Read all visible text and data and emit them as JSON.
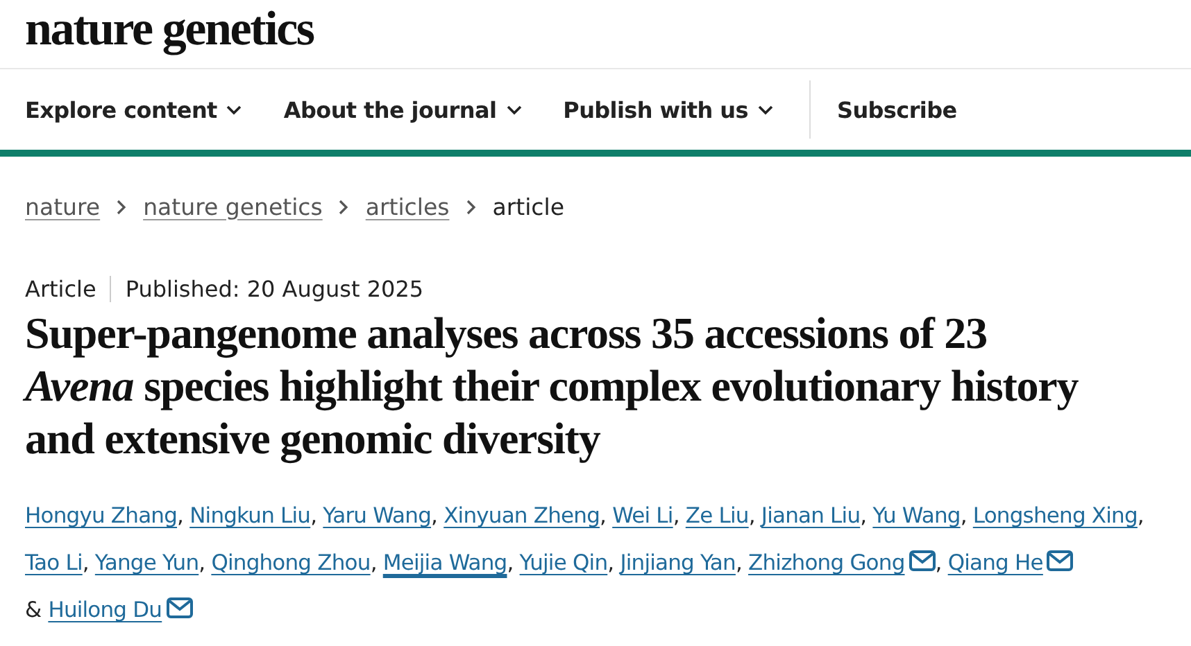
{
  "logo": "nature genetics",
  "nav": [
    {
      "label": "Explore content",
      "dropdown": true
    },
    {
      "label": "About the journal",
      "dropdown": true
    },
    {
      "label": "Publish with us",
      "dropdown": true
    },
    {
      "label": "Subscribe",
      "dropdown": false
    }
  ],
  "breadcrumbs": [
    {
      "label": "nature",
      "link": true
    },
    {
      "label": "nature genetics",
      "link": true
    },
    {
      "label": "articles",
      "link": true
    },
    {
      "label": "article",
      "link": false
    }
  ],
  "article_type": "Article",
  "published": "Published: 20 August 2025",
  "title": "Super-pangenome analyses across 35 accessions of 23 *Avena* species highlight their complex evolutionary history and extensive genomic diversity",
  "authors": {
    "separator": ",",
    "last_joiner": "&",
    "list": [
      {
        "name": "Hongyu Zhang",
        "email": false,
        "hovered": false
      },
      {
        "name": "Ningkun Liu",
        "email": false,
        "hovered": false
      },
      {
        "name": "Yaru Wang",
        "email": false,
        "hovered": false
      },
      {
        "name": "Xinyuan Zheng",
        "email": false,
        "hovered": false
      },
      {
        "name": "Wei Li",
        "email": false,
        "hovered": false
      },
      {
        "name": "Ze Liu",
        "email": false,
        "hovered": false
      },
      {
        "name": "Jianan Liu",
        "email": false,
        "hovered": false
      },
      {
        "name": "Yu Wang",
        "email": false,
        "hovered": false
      },
      {
        "name": "Longsheng Xing",
        "email": false,
        "hovered": false
      },
      {
        "name": "Tao Li",
        "email": false,
        "hovered": false
      },
      {
        "name": "Yange Yun",
        "email": false,
        "hovered": false
      },
      {
        "name": "Qinghong Zhou",
        "email": false,
        "hovered": false
      },
      {
        "name": "Meijia Wang",
        "email": false,
        "hovered": true
      },
      {
        "name": "Yujie Qin",
        "email": false,
        "hovered": false
      },
      {
        "name": "Jinjiang Yan",
        "email": false,
        "hovered": false
      },
      {
        "name": "Zhizhong Gong",
        "email": true,
        "hovered": false
      },
      {
        "name": "Qiang He",
        "email": true,
        "hovered": false
      },
      {
        "name": "Huilong Du",
        "email": true,
        "hovered": false
      }
    ]
  }
}
